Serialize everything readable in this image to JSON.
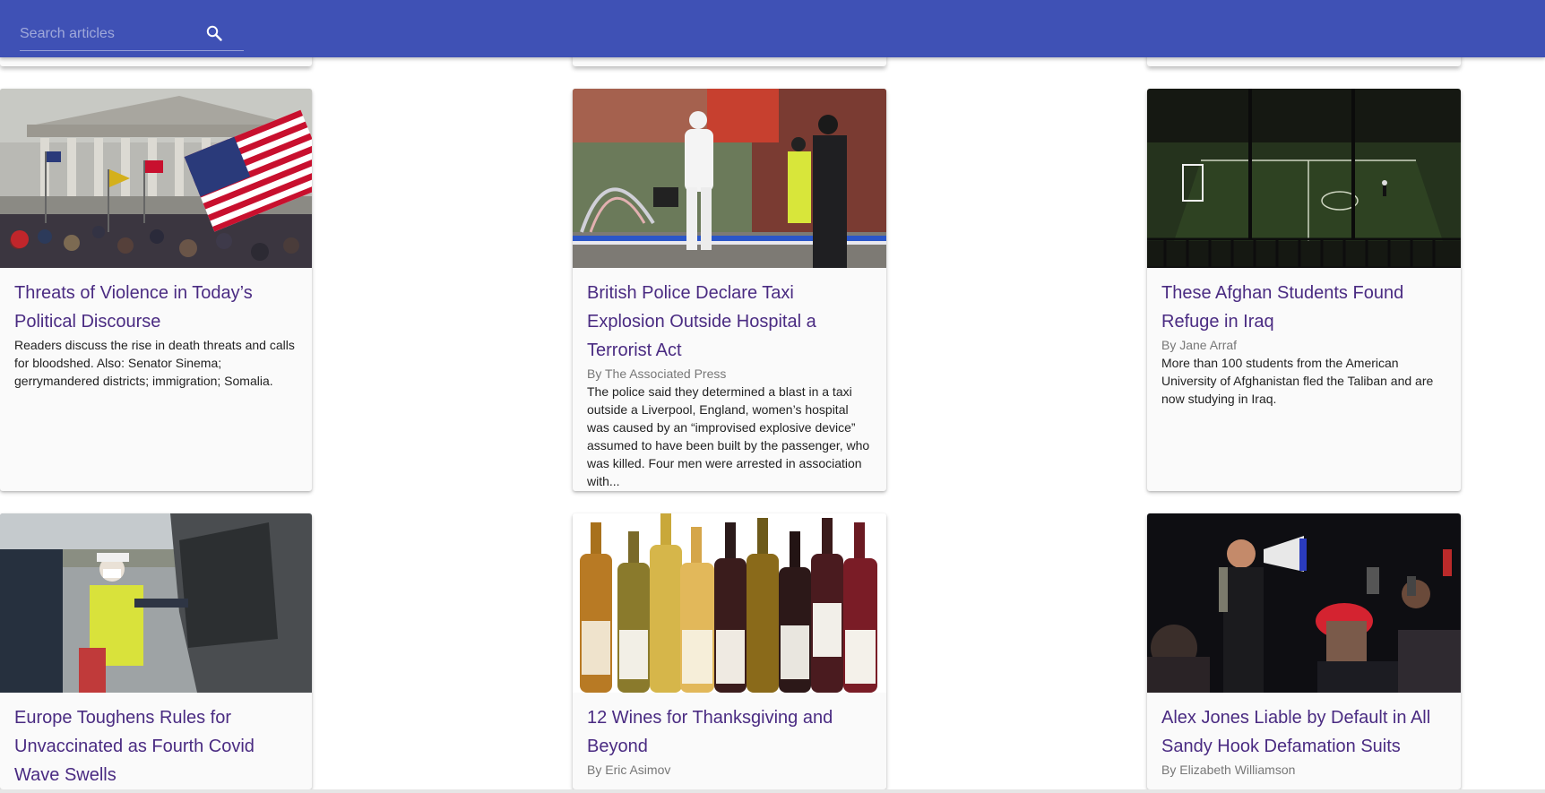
{
  "search": {
    "placeholder": "Search articles",
    "value": "",
    "icon": "search-icon"
  },
  "theme": {
    "appbar": "#3f51b5",
    "title_link": "#4a2b82",
    "byline": "#777777"
  },
  "articles": [
    {
      "title": "Threats of Violence in Today’s Political Discourse",
      "byline": "",
      "description": "Readers discuss the rise in death threats and calls for bloodshed. Also: Senator Sinema; gerrymandered districts; immigration; Somalia."
    },
    {
      "title": "British Police Declare Taxi Explosion Outside Hospital a Terrorist Act",
      "byline": "By The Associated Press",
      "description": "The police said they determined a blast in a taxi outside a Liverpool, England, women’s hospital was caused by an “improvised explosive device” assumed to have been built by the passenger, who was killed. Four men were arrested in association with..."
    },
    {
      "title": "These Afghan Students Found Refuge in Iraq",
      "byline": "By Jane Arraf",
      "description": "More than 100 students from the American University of Afghanistan fled the Taliban and are now studying in Iraq."
    },
    {
      "title": "Europe Toughens Rules for Unvaccinated as Fourth Covid Wave Swells",
      "byline": "",
      "description": ""
    },
    {
      "title": "12 Wines for Thanksgiving and Beyond",
      "byline": "By Eric Asimov",
      "description": ""
    },
    {
      "title": "Alex Jones Liable by Default in All Sandy Hook Defamation Suits",
      "byline": "By Elizabeth Williamson",
      "description": ""
    }
  ]
}
